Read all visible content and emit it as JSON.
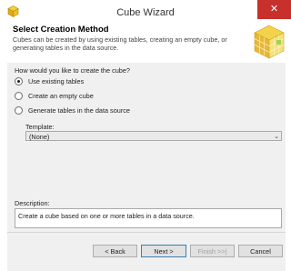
{
  "window": {
    "title": "Cube Wizard",
    "close_glyph": "✕",
    "icon": "cube-app-icon"
  },
  "header": {
    "title": "Select Creation Method",
    "description": "Cubes can be created by using existing tables, creating an empty cube, or generating tables in the data source."
  },
  "main": {
    "question": "How would you like to create the cube?",
    "options": [
      {
        "label": "Use existing tables",
        "checked": true
      },
      {
        "label": "Create an empty cube",
        "checked": false
      },
      {
        "label": "Generate tables in the data source",
        "checked": false
      }
    ],
    "template_label": "Template:",
    "template_value": "(None)",
    "description_label": "Description:",
    "description_text": "Create a cube based on one or more tables in a data source."
  },
  "footer": {
    "back": "< Back",
    "next": "Next >",
    "finish": "Finish >>|",
    "cancel": "Cancel"
  },
  "colors": {
    "close": "#c7302b",
    "accent": "#3c7fb1"
  }
}
